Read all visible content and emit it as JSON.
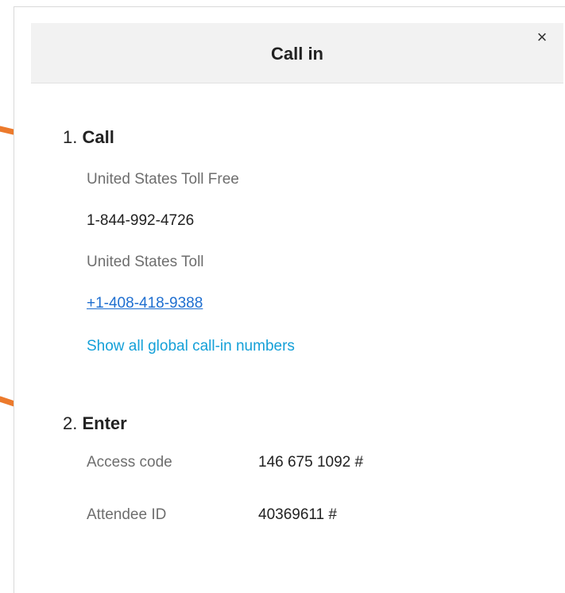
{
  "dialog": {
    "title": "Call in",
    "close_glyph": "×"
  },
  "step1": {
    "number": "1.",
    "label": "Call",
    "toll_free_label": "United States Toll Free",
    "toll_free_number": "1-844-992-4726",
    "toll_label": "United States Toll",
    "toll_number": "+1-408-418-9388",
    "global_link": "Show all global call-in numbers"
  },
  "step2": {
    "number": "2.",
    "label": "Enter",
    "access_code_label": "Access code",
    "access_code_value": "146 675 1092 #",
    "attendee_id_label": "Attendee ID",
    "attendee_id_value": "40369611 #"
  },
  "colors": {
    "arrow": "#ec7a2c",
    "link_phone": "#1f6fd0",
    "link_global": "#14a0d8"
  }
}
